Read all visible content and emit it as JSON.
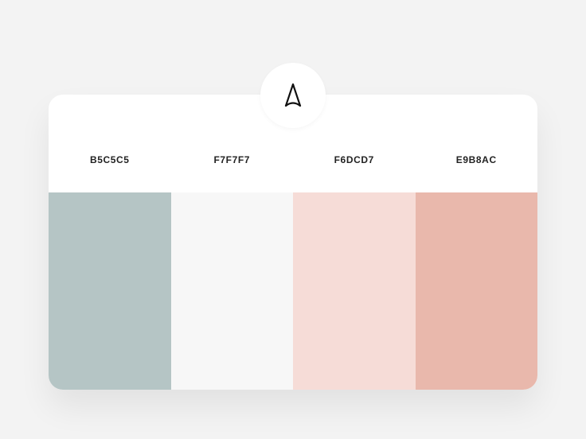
{
  "palette": [
    {
      "hex_label": "B5C5C5",
      "color": "#b5c5c5"
    },
    {
      "hex_label": "F7F7F7",
      "color": "#f7f7f7"
    },
    {
      "hex_label": "F6DCD7",
      "color": "#f6dcd7"
    },
    {
      "hex_label": "E9B8AC",
      "color": "#e9b8ac"
    }
  ],
  "logo_icon": "a-shaped-logo-icon"
}
